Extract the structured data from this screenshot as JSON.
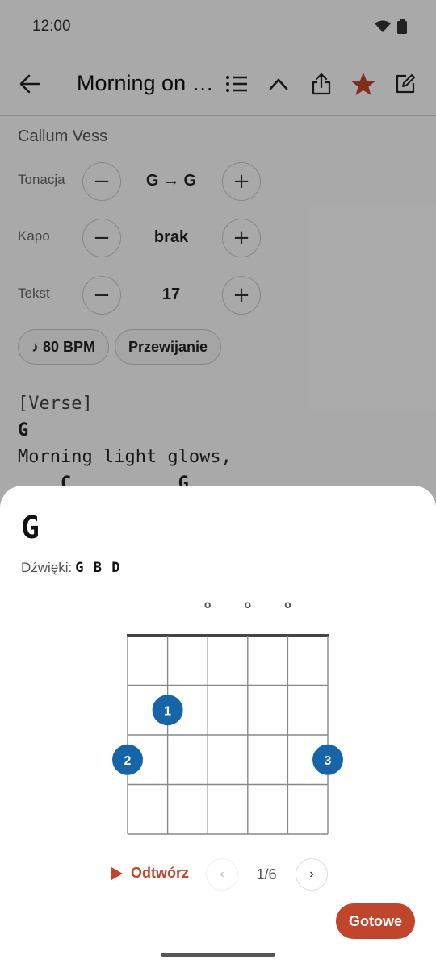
{
  "status_bar": {
    "time": "12:00",
    "icons": [
      "wifi-icon",
      "battery-icon"
    ]
  },
  "app_bar": {
    "title": "Morning on the Hill",
    "icons": [
      "back-arrow-icon",
      "list-icon",
      "chevron-up-icon",
      "share-icon",
      "star-icon",
      "edit-icon"
    ],
    "star_color": "#c0452a"
  },
  "song": {
    "artist": "Callum Vess",
    "controls": [
      {
        "label": "Tonacja",
        "value": "G → G",
        "minus": "−",
        "plus": "+"
      },
      {
        "label": "Kapo",
        "value": "brak",
        "minus": "−",
        "plus": "+"
      },
      {
        "label": "Tekst",
        "value": "17",
        "minus": "−",
        "plus": "+"
      }
    ],
    "chips": [
      {
        "label": "♪ 80 BPM"
      },
      {
        "label": "Przewijanie"
      }
    ],
    "lyrics": {
      "section": "[Verse]",
      "chord_line_1": "G",
      "text_line_1": "Morning light glows,",
      "chord_line_2": "    C          G"
    }
  },
  "chord_sheet": {
    "name": "G",
    "notes_label": "Dźwięki:",
    "notes_value": "G B D",
    "open_markers": [
      "o",
      "o",
      "o"
    ],
    "fingers": [
      {
        "label": "1",
        "string": 2,
        "fret": 2
      },
      {
        "label": "2",
        "string": 1,
        "fret": 3
      },
      {
        "label": "3",
        "string": 6,
        "fret": 3
      }
    ],
    "play_label": "Odtwórz",
    "prev_label": "‹",
    "next_label": "›",
    "page_indicator": "1/6",
    "done_label": "Gotowe"
  },
  "colors": {
    "accent": "#c0452a",
    "chord_blue": "#1f5fa8",
    "finger_blue": "#1565a8"
  }
}
